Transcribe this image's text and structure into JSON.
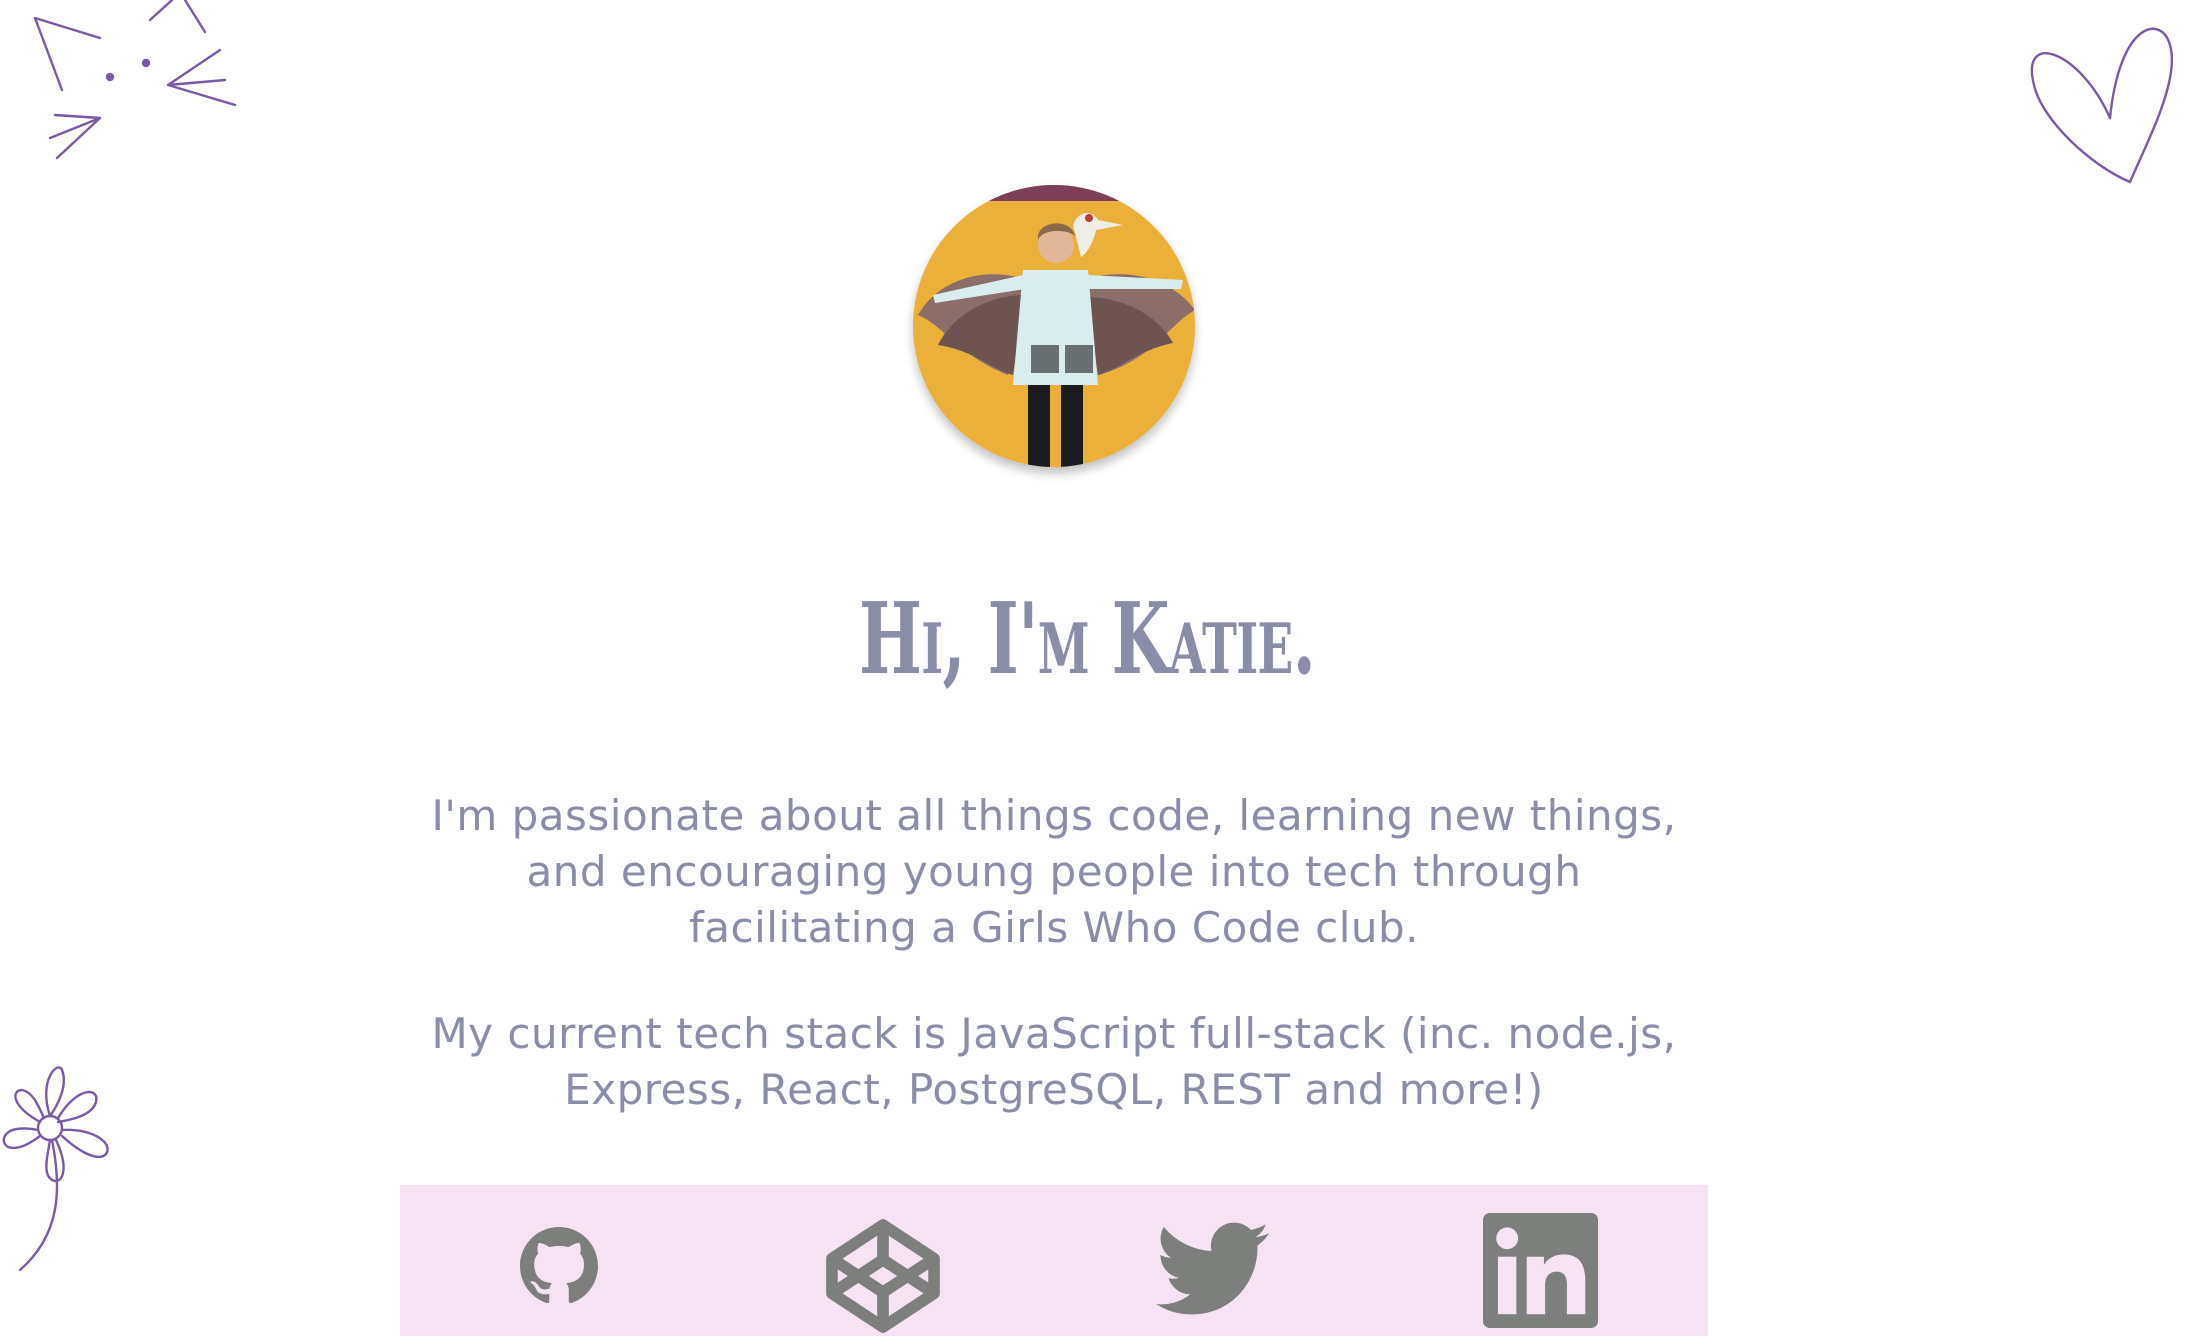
{
  "header": {
    "heading": "Hi, I'm Katie."
  },
  "avatar": {
    "alt": "Katie with painted wings"
  },
  "bio": {
    "paragraph_1": "I'm passionate about all things code, learning new things, and encouraging young people into tech through facilitating a Girls Who Code club.",
    "paragraph_2": "My current tech stack is JavaScript full-stack (inc. node.js, Express, React, PostgreSQL, REST and more!)"
  },
  "social": {
    "items": [
      {
        "name": "github",
        "icon": "github-icon"
      },
      {
        "name": "codepen",
        "icon": "codepen-icon"
      },
      {
        "name": "twitter",
        "icon": "twitter-icon"
      },
      {
        "name": "linkedin",
        "icon": "linkedin-icon"
      }
    ]
  },
  "colors": {
    "doodle": "#7a5aa6",
    "text": "#8a8da8",
    "social_bar_bg": "#f5e3f3",
    "icon_gray": "#7d7f7d"
  }
}
